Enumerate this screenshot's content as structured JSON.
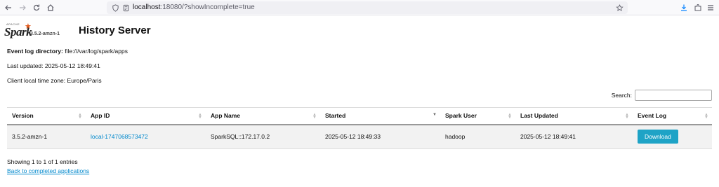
{
  "browser": {
    "url_host": "localhost",
    "url_rest": ":18080/?showIncomplete=true"
  },
  "app": {
    "logo_text": "Spark",
    "logo_apache": "APACHE",
    "version": "3.5.2-amzn-1",
    "title": "History Server"
  },
  "info": {
    "event_log_label": "Event log directory:",
    "event_log_value": "file:///var/log/spark/apps",
    "last_updated_label": "Last updated:",
    "last_updated_value": "2025-05-12 18:49:41",
    "timezone_label": "Client local time zone:",
    "timezone_value": "Europe/Paris"
  },
  "search": {
    "label": "Search:",
    "value": ""
  },
  "table": {
    "columns": [
      "Version",
      "App ID",
      "App Name",
      "Started",
      "Spark User",
      "Last Updated",
      "Event Log"
    ],
    "rows": [
      {
        "version": "3.5.2-amzn-1",
        "app_id": "local-1747068573472",
        "app_name": "SparkSQL::172.17.0.2",
        "started": "2025-05-12 18:49:33",
        "user": "hadoop",
        "last_updated": "2025-05-12 18:49:41",
        "event_log": "Download"
      }
    ]
  },
  "footer": {
    "showing": "Showing 1 to 1 of 1 entries",
    "back_link": "Back to completed applications"
  },
  "colors": {
    "link": "#0088cc",
    "button": "#1ea3c6",
    "spark_star": "#e25a1c"
  }
}
